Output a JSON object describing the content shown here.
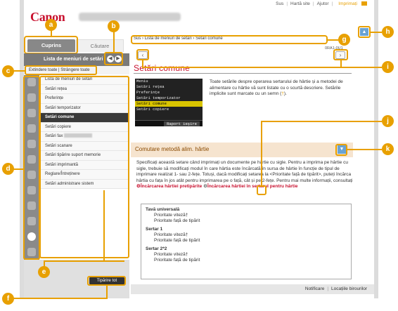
{
  "top_nav": {
    "home": "Sus",
    "sitemap": "Hartă site",
    "help": "Ajutor",
    "print": "Imprimați"
  },
  "brand": {
    "logo": "Canon"
  },
  "sidebar": {
    "tabs": {
      "contents": "Cuprins",
      "search": "Căutare"
    },
    "header": "Lista de meniuri de setări",
    "expand_all": "Extindere toate",
    "collapse_all": "Strângere toate",
    "print_all": "Tipărire tot",
    "items": [
      {
        "label": "Lista de meniuri de setări"
      },
      {
        "label": "Setări rețea"
      },
      {
        "label": "Preferințe"
      },
      {
        "label": "Setări temporizator"
      },
      {
        "label": "Setări comune",
        "active": true
      },
      {
        "label": "Setări copiere"
      },
      {
        "label": "Setări fax"
      },
      {
        "label": "Setări scanare"
      },
      {
        "label": "Setări tipărire suport memorie"
      },
      {
        "label": "Setări imprimantă"
      },
      {
        "label": "Reglare/Întreținere"
      },
      {
        "label": "Setări administrare sistem"
      }
    ]
  },
  "main": {
    "breadcrumb": [
      "Sus",
      "Lista de meniuri de setări",
      "Setări comune"
    ],
    "page_id": "0RA1-0U1",
    "title": "Setări comune",
    "intro": "Toate setările despre operarea sertarului de hârtie și a metodei de alimentare cu hârtie vă sunt listate cu o scurtă descriere. Setările implicite sunt marcate cu un semn (",
    "intro_ref": "†",
    "intro_end": ").",
    "screen_menu": {
      "items": [
        "Meniu",
        "Setări rețea",
        "Preferințe",
        "Setări temporizator",
        "Setări comune",
        "Setări copiere"
      ],
      "selected": "Setări comune",
      "exit": "Raport ieșire"
    },
    "section": {
      "title": "Comutare metodă alim. hârtie",
      "text": "Specificați această setare când imprimați un documente pe hârtie cu sigle. Pentru a imprima pe hârtie cu sigle, trebuie să modificați modul în care hârtia este încărcată în sursa de hârtie în funcție de tipul de imprimare realizat 1- sau 2-fețe. Totuși, dacă modificați setarea la <Prioritate față de tipărit>, puteți încărca hârtia cu fața în jos atât pentru imprimarea pe o față, cât și pe 2-fețe. Pentru mai multe informații, consultați",
      "link_1": "Încărcarea hârtiei pretipărite",
      "link_2": "Încărcarea hârtiei în sertarul pentru hârtie",
      "groups": [
        {
          "name": "Tavă universală",
          "items": [
            "Prioritate viteză†",
            "Prioritate față de tipărit"
          ]
        },
        {
          "name": "Sertar 1",
          "items": [
            "Prioritate viteză†",
            "Prioritate față de tipărit"
          ]
        },
        {
          "name": "Sertar 2*2",
          "items": [
            "Prioritate viteză†",
            "Prioritate față de tipărit"
          ]
        }
      ]
    }
  },
  "footer": {
    "notices": "Notificare",
    "offices": "Locațiile birourilor"
  },
  "callouts": [
    "a",
    "b",
    "c",
    "d",
    "e",
    "f",
    "g",
    "h",
    "i",
    "j",
    "k"
  ],
  "colors": {
    "accent": "#e8a000",
    "brand": "#c8102e",
    "sidebar_header": "#7a7a7a",
    "active_item": "#3a3a3a",
    "section_bg": "#f6e4cf",
    "toggle": "#6aa3d3"
  }
}
